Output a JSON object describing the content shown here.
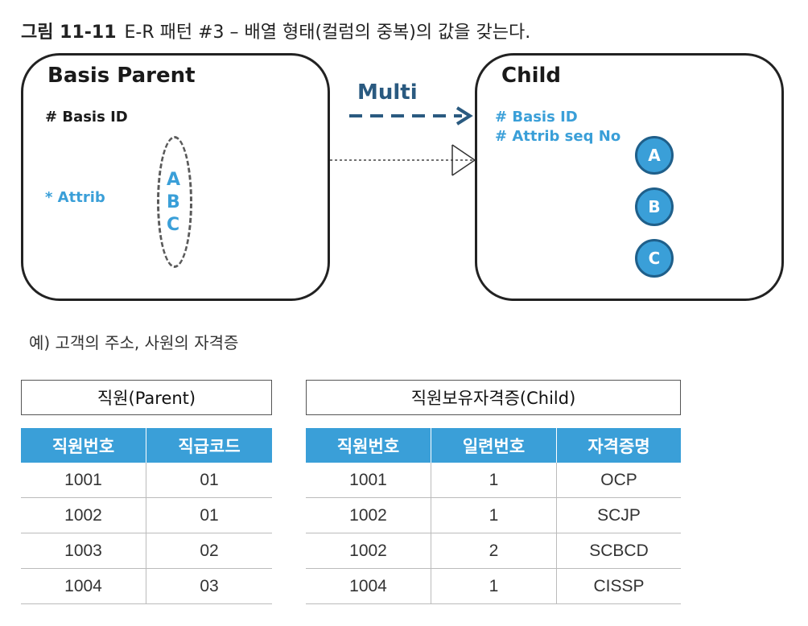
{
  "caption": {
    "number": "그림 11-11",
    "text": "E-R 패턴 #3 – 배열 형태(컬럼의 중복)의 값을 갖는다."
  },
  "parent_entity": {
    "title": "Basis Parent",
    "id_attr": "# Basis ID",
    "attr": "* Attrib",
    "array_values": [
      "A",
      "B",
      "C"
    ]
  },
  "relationship": {
    "label": "Multi"
  },
  "child_entity": {
    "title": "Child",
    "attrs": [
      "# Basis ID",
      "# Attrib seq No"
    ],
    "values": [
      "A",
      "B",
      "C"
    ]
  },
  "example": "예) 고객의 주소, 사원의 자격증",
  "parent_table": {
    "title": "직원(Parent)",
    "headers": [
      "직원번호",
      "직급코드"
    ],
    "rows": [
      [
        "1001",
        "01"
      ],
      [
        "1002",
        "01"
      ],
      [
        "1003",
        "02"
      ],
      [
        "1004",
        "03"
      ]
    ]
  },
  "child_table": {
    "title": "직원보유자격증(Child)",
    "headers": [
      "직원번호",
      "일련번호",
      "자격증명"
    ],
    "rows": [
      [
        "1001",
        "1",
        "OCP"
      ],
      [
        "1002",
        "1",
        "SCJP"
      ],
      [
        "1002",
        "2",
        "SCBCD"
      ],
      [
        "1004",
        "1",
        "CISSP"
      ]
    ]
  },
  "colors": {
    "accent_blue": "#3a9fd8",
    "arrow": "#2a5a80",
    "circle_border": "#1f5f8a"
  }
}
